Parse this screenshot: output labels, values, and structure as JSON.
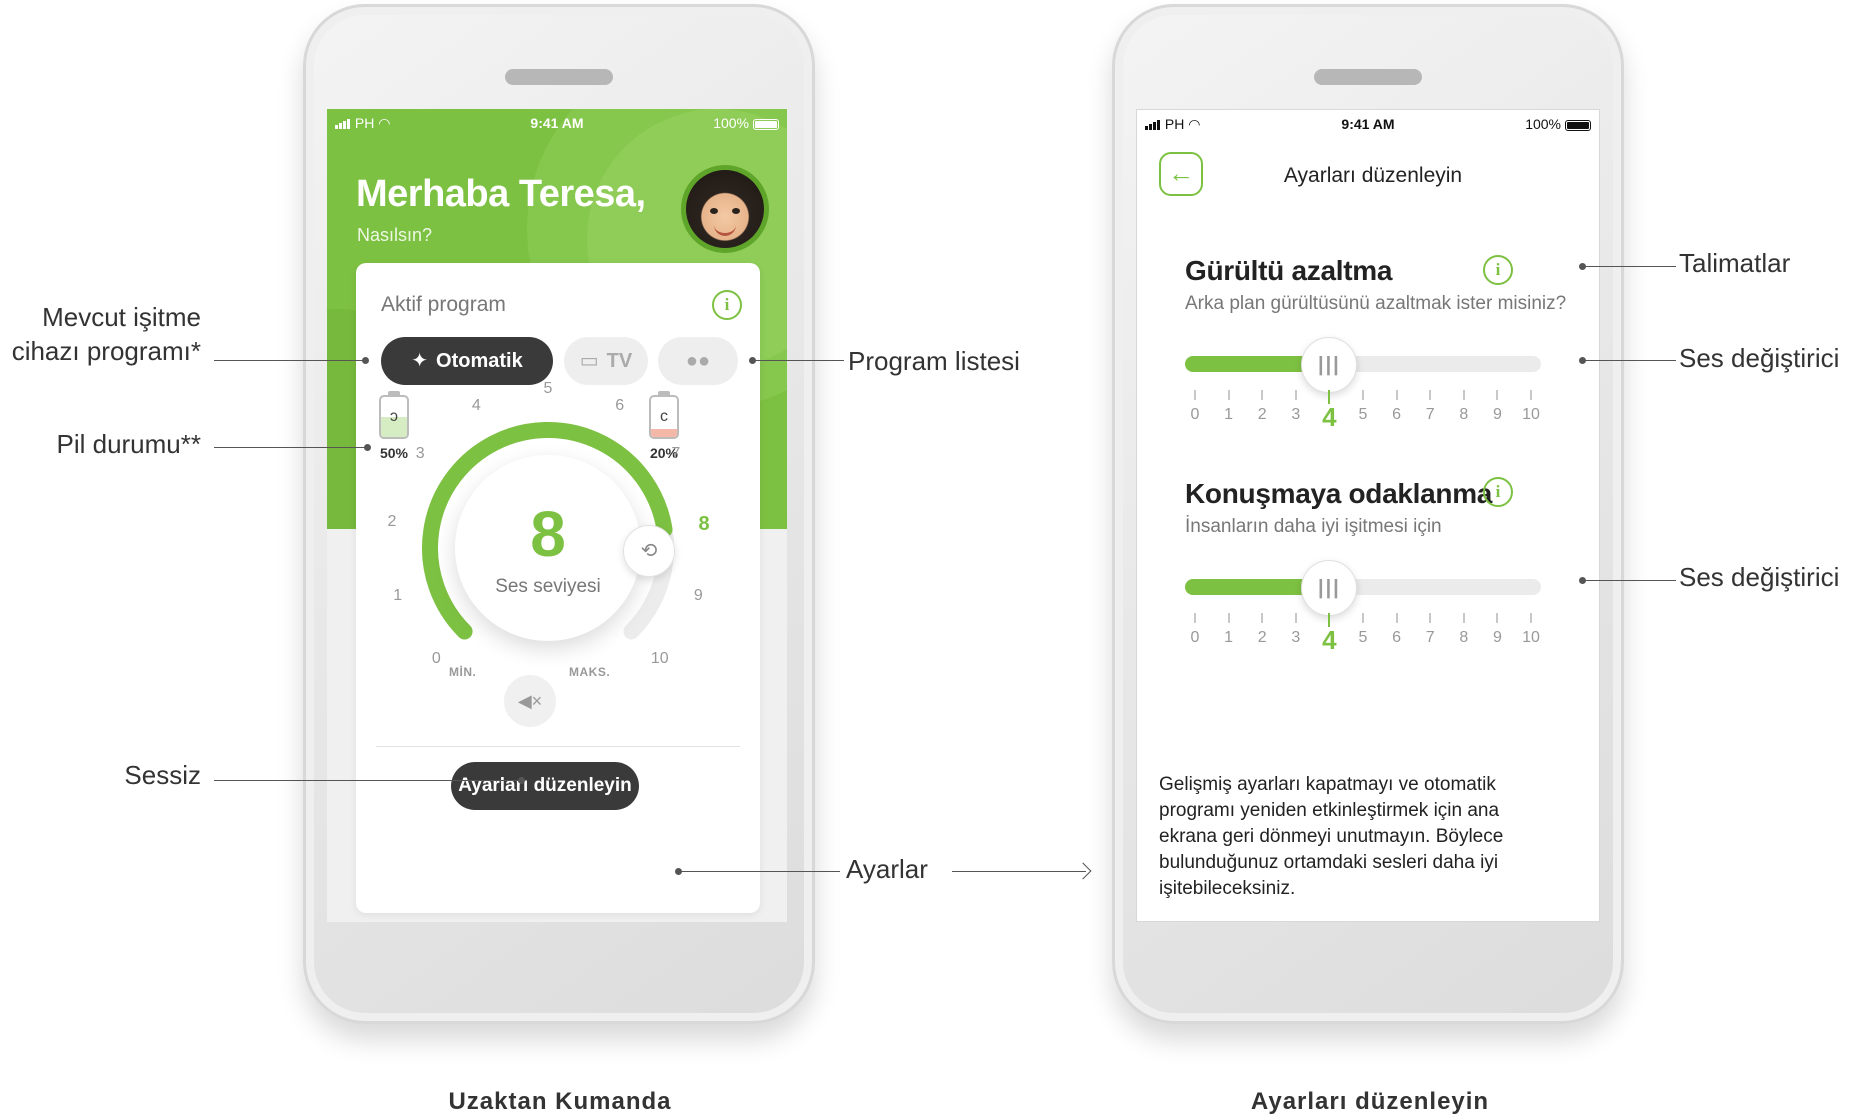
{
  "remote": {
    "status": {
      "carrier": "PH",
      "time": "9:41 AM",
      "battery": "100%"
    },
    "greeting": "Merhaba Teresa,",
    "subgreeting": "Nasılsın?",
    "active_program_title": "Aktif program",
    "programs": [
      {
        "label": "Otomatik",
        "icon": "magic-wand-icon",
        "selected": true
      },
      {
        "label": "TV",
        "icon": "tv-icon",
        "selected": false
      },
      {
        "label": "",
        "icon": "people-icon",
        "selected": false
      }
    ],
    "batteries": [
      {
        "side": "left",
        "percent": "50%",
        "level": 0.5,
        "color": "#d6ecc2"
      },
      {
        "side": "right",
        "percent": "20%",
        "level": 0.2,
        "color": "#f3b8a8"
      }
    ],
    "dial": {
      "numbers": [
        "0",
        "1",
        "2",
        "3",
        "4",
        "5",
        "6",
        "7",
        "8",
        "9",
        "10"
      ],
      "value": 8,
      "value_label": "8",
      "label": "Ses seviyesi",
      "min_label": "MİN.",
      "max_label": "MAKS.",
      "accent": "#7dc142"
    },
    "edit_button": "Ayarları düzenleyin"
  },
  "settings": {
    "status": {
      "carrier": "PH",
      "time": "9:41 AM",
      "battery": "100%"
    },
    "title": "Ayarları düzenleyin",
    "noise": {
      "title": "Gürültü azaltma",
      "subtitle": "Arka plan gürültüsünü azaltmak ister misiniz?",
      "value": 4,
      "value_label": "4"
    },
    "speech": {
      "title": "Konuşmaya odaklanma",
      "subtitle": "İnsanların daha iyi işitmesi için",
      "value": 4,
      "value_label": "4"
    },
    "scale": [
      "0",
      "1",
      "2",
      "3",
      "4",
      "5",
      "6",
      "7",
      "8",
      "9",
      "10"
    ],
    "note": "Gelişmiş ayarları kapatmayı ve otomatik programı yeniden etkinleştirmek için ana ekrana geri dönmeyi unutmayın. Böylece bulunduğunuz ortamdaki sesleri daha iyi işitebileceksiniz."
  },
  "callouts": {
    "current_program": "Mevcut işitme\ncihazı programı*",
    "program_list": "Program listesi",
    "battery": "Pil durumu**",
    "mute": "Sessiz",
    "settings": "Ayarlar",
    "instructions": "Talimatlar",
    "volume_changer_1": "Ses değiştirici",
    "volume_changer_2": "Ses değiştirici"
  },
  "captions": {
    "left": "Uzaktan Kumanda",
    "right": "Ayarları düzenleyin"
  },
  "colors": {
    "brand_green": "#7dc142",
    "dark_button": "#3a3a3a"
  }
}
